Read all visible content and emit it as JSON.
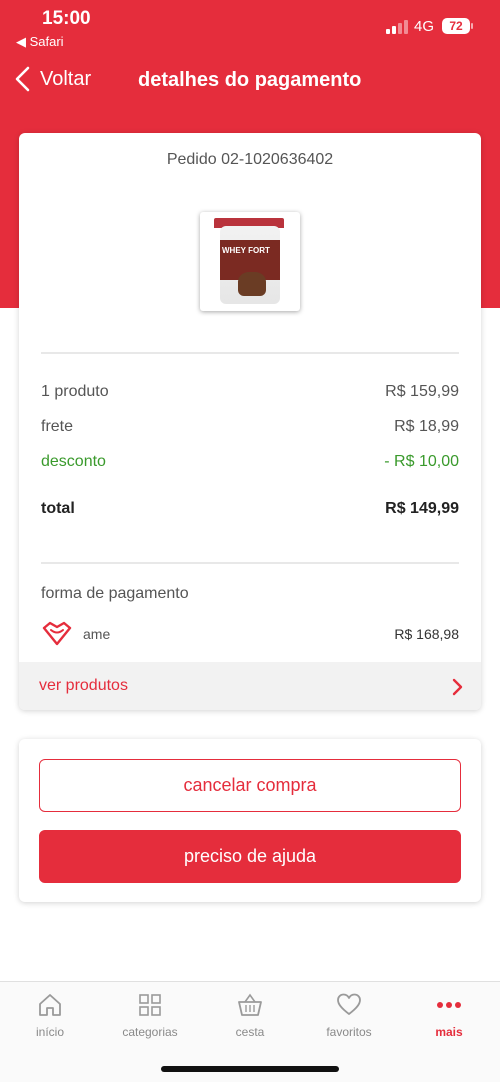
{
  "status_bar": {
    "time": "15:00",
    "back_app": "◀ Safari",
    "network": "4G",
    "battery": "72"
  },
  "nav": {
    "back_label": "Voltar",
    "title": "detalhes do pagamento"
  },
  "order": {
    "id_label": "Pedido 02-1020636402",
    "product_image_text": "WHEY FORT",
    "summary": [
      {
        "label": "1 produto",
        "amount": "R$ 159,99"
      },
      {
        "label": "frete",
        "amount": "R$ 18,99"
      },
      {
        "label": "desconto",
        "amount": "- R$ 10,00"
      }
    ],
    "total": {
      "label": "total",
      "amount": "R$ 149,99"
    },
    "payment": {
      "title": "forma de pagamento",
      "method_name": "ame",
      "method_amount": "R$ 168,98"
    },
    "ver_produtos": "ver produtos"
  },
  "actions": {
    "cancel": "cancelar compra",
    "help": "preciso de ajuda"
  },
  "tabbar": {
    "items": [
      {
        "label": "início",
        "icon": "home-icon"
      },
      {
        "label": "categorias",
        "icon": "grid-icon"
      },
      {
        "label": "cesta",
        "icon": "basket-icon"
      },
      {
        "label": "favoritos",
        "icon": "heart-icon"
      },
      {
        "label": "mais",
        "icon": "more-icon"
      }
    ],
    "active": "mais"
  },
  "colors": {
    "brand_red": "#e52d3c",
    "discount_green": "#3a9a2c"
  }
}
